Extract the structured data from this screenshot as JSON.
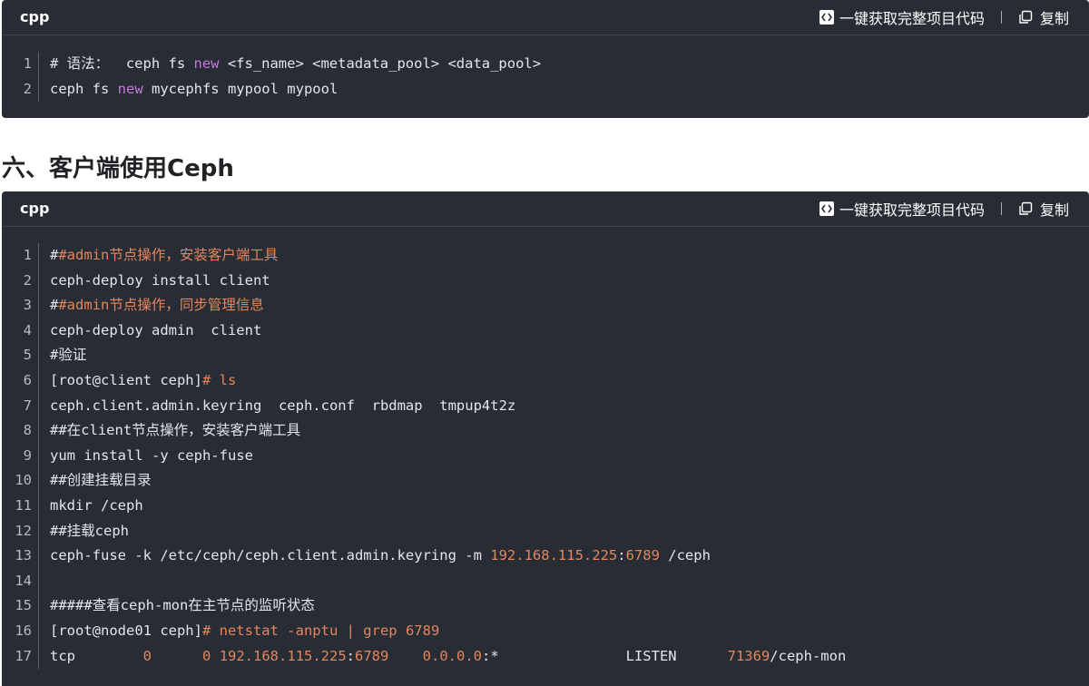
{
  "colors": {
    "bg": "#282c34",
    "comment": "#e5865c",
    "keyword": "#c678dd",
    "text": "#e3e6eb"
  },
  "toolbar": {
    "get_code_label": "一键获取完整项目代码",
    "copy_label": "复制"
  },
  "block1": {
    "lang": "cpp",
    "lines": [
      {
        "n": "1",
        "parts": [
          [
            "t",
            "# 语法：  ceph fs "
          ],
          [
            "kw",
            "new"
          ],
          [
            "t",
            " <fs_name> <metadata_pool> <data_pool>"
          ]
        ]
      },
      {
        "n": "2",
        "parts": [
          [
            "t",
            "ceph fs "
          ],
          [
            "kw",
            "new"
          ],
          [
            "t",
            " mycephfs mypool mypool"
          ]
        ]
      }
    ]
  },
  "section_title": "六、客户端使用Ceph",
  "block2": {
    "lang": "cpp",
    "lines": [
      {
        "n": "1",
        "parts": [
          [
            "t",
            "#"
          ],
          [
            "cm",
            "#admin节点操作，安装客户端工具"
          ]
        ]
      },
      {
        "n": "2",
        "parts": [
          [
            "t",
            "ceph-deploy install client"
          ]
        ]
      },
      {
        "n": "3",
        "parts": [
          [
            "t",
            "#"
          ],
          [
            "cm",
            "#admin节点操作，同步管理信息"
          ]
        ]
      },
      {
        "n": "4",
        "parts": [
          [
            "t",
            "ceph-deploy admin  client"
          ]
        ]
      },
      {
        "n": "5",
        "parts": [
          [
            "t",
            "#验证"
          ]
        ]
      },
      {
        "n": "6",
        "parts": [
          [
            "t",
            "[root@client ceph]"
          ],
          [
            "cm",
            "# ls"
          ]
        ]
      },
      {
        "n": "7",
        "parts": [
          [
            "t",
            "ceph.client.admin.keyring  ceph.conf  rbdmap  tmpup4t2z"
          ]
        ]
      },
      {
        "n": "8",
        "parts": [
          [
            "t",
            "##在client节点操作，安装客户端工具"
          ]
        ]
      },
      {
        "n": "9",
        "parts": [
          [
            "t",
            "yum install -y ceph-fuse"
          ]
        ]
      },
      {
        "n": "10",
        "parts": [
          [
            "t",
            "##创建挂载目录"
          ]
        ]
      },
      {
        "n": "11",
        "parts": [
          [
            "t",
            "mkdir /ceph"
          ]
        ]
      },
      {
        "n": "12",
        "parts": [
          [
            "t",
            "##挂载ceph"
          ]
        ]
      },
      {
        "n": "13",
        "parts": [
          [
            "t",
            "ceph-fuse -k /etc/ceph/ceph.client.admin.keyring -m "
          ],
          [
            "num",
            "192.168.115.225"
          ],
          [
            "t",
            ":"
          ],
          [
            "num",
            "6789"
          ],
          [
            "t",
            " /ceph"
          ]
        ]
      },
      {
        "n": "14",
        "parts": [
          [
            "t",
            ""
          ]
        ]
      },
      {
        "n": "15",
        "parts": [
          [
            "t",
            "#####查看ceph-mon在主节点的监听状态"
          ]
        ]
      },
      {
        "n": "16",
        "parts": [
          [
            "t",
            "[root@node01 ceph]"
          ],
          [
            "cm",
            "# netstat -anptu | grep 6789"
          ]
        ]
      },
      {
        "n": "17",
        "parts": [
          [
            "t",
            "tcp        "
          ],
          [
            "num",
            "0"
          ],
          [
            "t",
            "      "
          ],
          [
            "num",
            "0"
          ],
          [
            "t",
            " "
          ],
          [
            "num",
            "192.168.115.225"
          ],
          [
            "t",
            ":"
          ],
          [
            "num",
            "6789"
          ],
          [
            "t",
            "    "
          ],
          [
            "num",
            "0.0.0.0"
          ],
          [
            "t",
            ":*               LISTEN      "
          ],
          [
            "num",
            "71369"
          ],
          [
            "t",
            "/ceph-mon"
          ]
        ]
      }
    ]
  }
}
